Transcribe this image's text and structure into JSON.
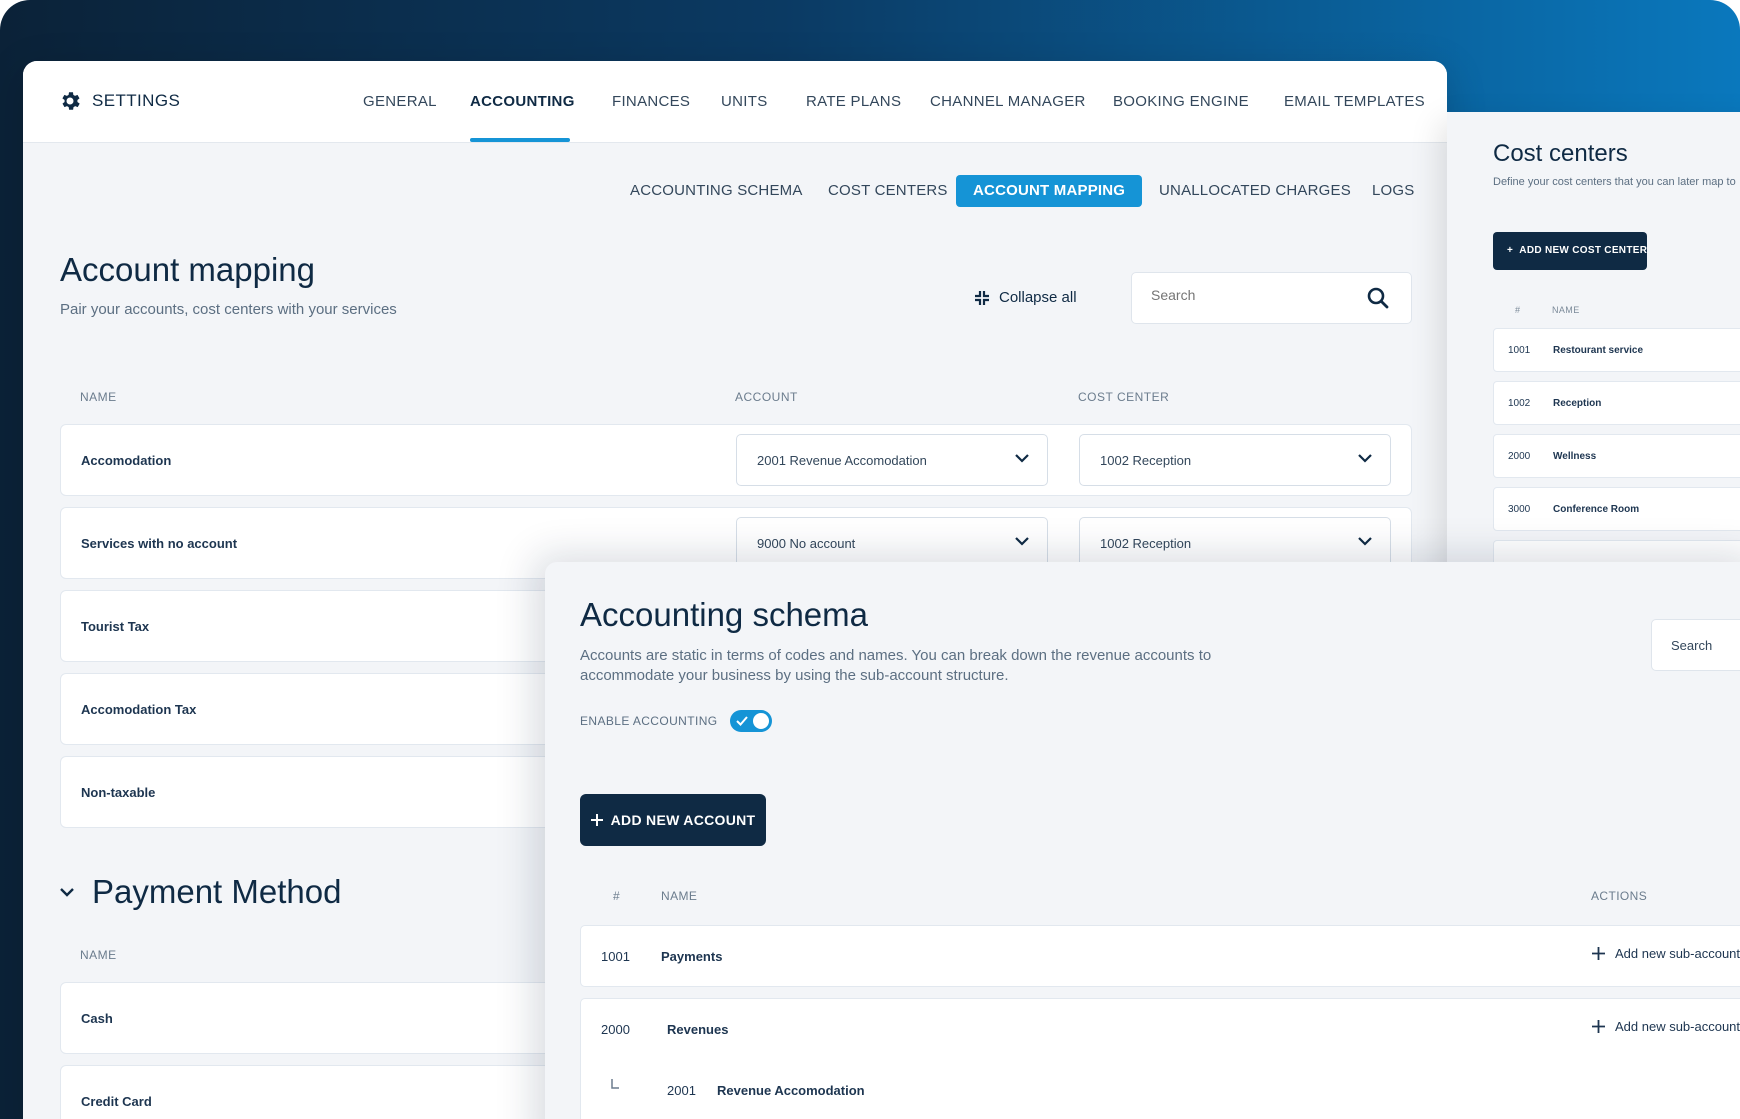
{
  "settings": {
    "brand": "SETTINGS",
    "tabs": [
      "GENERAL",
      "ACCOUNTING",
      "FINANCES",
      "UNITS",
      "RATE PLANS",
      "CHANNEL MANAGER",
      "BOOKING ENGINE",
      "EMAIL TEMPLATES"
    ],
    "active_tab": "ACCOUNTING",
    "subtabs": [
      "ACCOUNTING SCHEMA",
      "COST CENTERS",
      "ACCOUNT MAPPING",
      "UNALLOCATED CHARGES",
      "LOGS"
    ],
    "active_subtab": "ACCOUNT MAPPING"
  },
  "mapping": {
    "title": "Account mapping",
    "subtitle": "Pair your accounts, cost centers with your services",
    "collapse_label": "Collapse all",
    "search_placeholder": "Search",
    "columns": [
      "NAME",
      "ACCOUNT",
      "COST CENTER"
    ],
    "rows": [
      {
        "name": "Accomodation",
        "account": "2001 Revenue Accomodation",
        "cost_center": "1002 Reception"
      },
      {
        "name": "Services with no account",
        "account": "9000 No account",
        "cost_center": "1002 Reception"
      },
      {
        "name": "Tourist Tax"
      },
      {
        "name": "Accomodation Tax"
      },
      {
        "name": "Non-taxable"
      }
    ],
    "payment_section": {
      "title": "Payment Method",
      "column": "NAME",
      "rows": [
        {
          "name": "Cash"
        },
        {
          "name": "Credit Card"
        }
      ]
    }
  },
  "cost_centers": {
    "title": "Cost centers",
    "subtitle": "Define your cost centers that you can later map to",
    "add_button": "ADD NEW COST CENTER",
    "columns": [
      "#",
      "NAME"
    ],
    "rows": [
      {
        "code": "1001",
        "name": "Restourant service"
      },
      {
        "code": "1002",
        "name": "Reception"
      },
      {
        "code": "2000",
        "name": "Wellness"
      },
      {
        "code": "3000",
        "name": "Conference Room"
      }
    ]
  },
  "schema": {
    "title": "Accounting schema",
    "description": "Accounts are static in terms of codes and names. You can break down the revenue accounts to accommodate your business by using the sub-account structure.",
    "search_placeholder": "Search",
    "enable_label": "ENABLE ACCOUNTING",
    "enabled": true,
    "add_button": "ADD NEW ACCOUNT",
    "columns": [
      "#",
      "NAME",
      "ACTIONS"
    ],
    "rows": [
      {
        "code": "1001",
        "name": "Payments",
        "action": "Add new sub-account"
      },
      {
        "code": "2000",
        "name": "Revenues",
        "action": "Add new sub-account"
      }
    ],
    "sub_rows": [
      {
        "code": "2001",
        "name": "Revenue Accomodation"
      }
    ]
  },
  "colors": {
    "accent": "#1594d6",
    "navy": "#0f2a44",
    "panel_bg": "#f3f5f8"
  }
}
